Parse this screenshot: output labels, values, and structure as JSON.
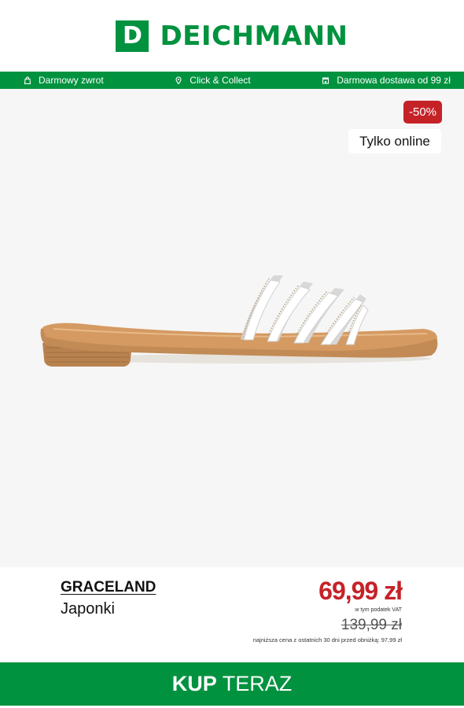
{
  "header": {
    "logo_letter": "D",
    "logo_text": "DEICHMANN",
    "brand_color": "#00923f"
  },
  "benefits": [
    {
      "icon": "return-bag-icon",
      "label": "Darmowy zwrot"
    },
    {
      "icon": "location-pin-icon",
      "label": "Click & Collect"
    },
    {
      "icon": "store-icon",
      "label": "Darmowa dostawa od 99 zł"
    }
  ],
  "product": {
    "discount_badge": "-50%",
    "online_badge": "Tylko online",
    "brand": "GRACELAND",
    "name": "Japonki",
    "price": "69,99 zł",
    "vat_note": "w tym podatek VAT",
    "old_price": "139,99 zł",
    "lowest_price_note": "najniższa cena z ostatnich 30 dni przed obniżką: 97,99 zł",
    "price_color": "#c52228"
  },
  "cta": {
    "strong": "KUP",
    "rest": "TERAZ"
  }
}
